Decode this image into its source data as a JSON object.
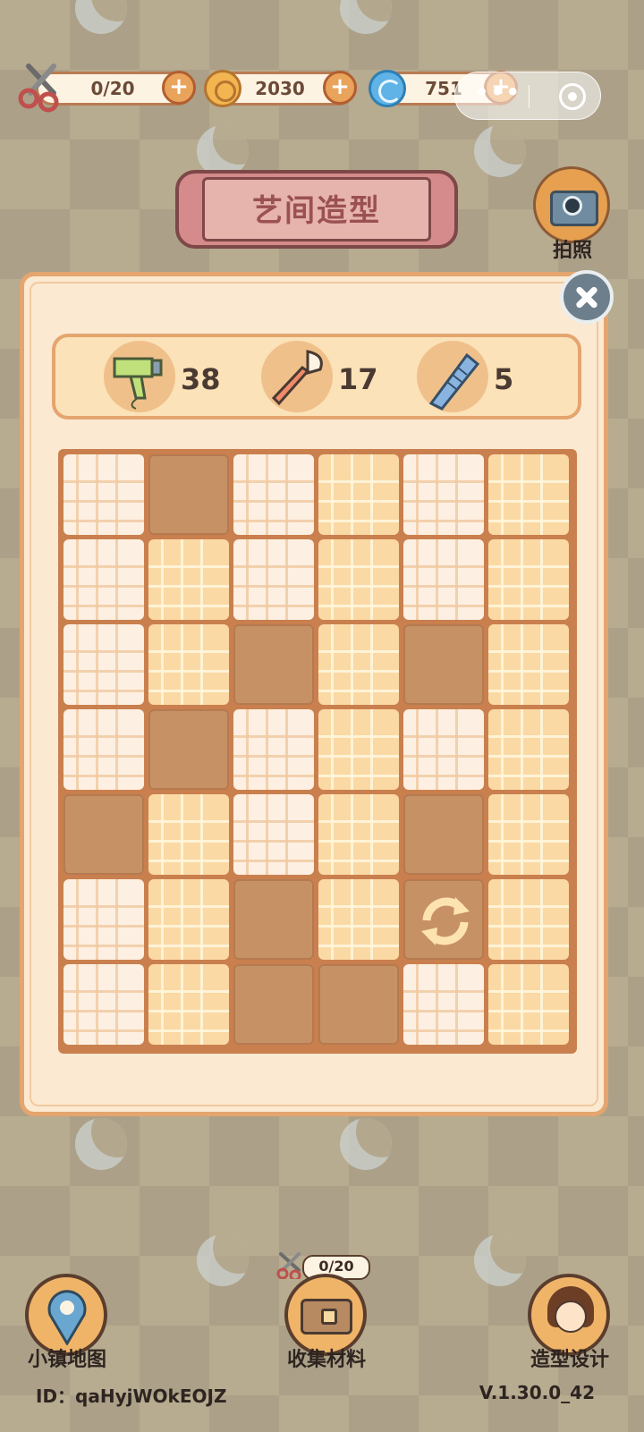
{
  "resources": {
    "scissors": {
      "value": "0/20",
      "icon": "scissors-icon"
    },
    "coins": {
      "value": "2030",
      "icon": "coin-icon"
    },
    "gems": {
      "value": "751",
      "icon": "swirl-gem-icon"
    }
  },
  "capsule": {
    "dots": "•••"
  },
  "title": "艺间造型",
  "camera_label": "拍照",
  "tools": [
    {
      "icon": "hair-dryer-icon",
      "count": "38"
    },
    {
      "icon": "makeup-brush-icon",
      "count": "17"
    },
    {
      "icon": "comb-icon",
      "count": "5"
    }
  ],
  "board": {
    "rows": [
      [
        "light",
        "empty",
        "light",
        "yellow",
        "light",
        "yellow"
      ],
      [
        "light",
        "yellow",
        "light",
        "yellow",
        "light",
        "yellow"
      ],
      [
        "light",
        "yellow",
        "empty",
        "yellow",
        "empty",
        "yellow"
      ],
      [
        "light",
        "empty",
        "light",
        "yellow",
        "light",
        "yellow"
      ],
      [
        "empty",
        "yellow",
        "light",
        "yellow",
        "empty",
        "yellow"
      ],
      [
        "light",
        "yellow",
        "empty",
        "yellow",
        "refresh",
        "yellow"
      ],
      [
        "light",
        "yellow",
        "empty",
        "empty",
        "light",
        "yellow"
      ]
    ]
  },
  "bottom": {
    "map_label": "小镇地图",
    "collect_label": "收集材料",
    "collect_counter": "0/20",
    "design_label": "造型设计"
  },
  "footer": {
    "id": "ID：qaHyjWOkEOJZ",
    "version": "V.1.30.0_42"
  },
  "colors": {
    "accent": "#e4a56f",
    "panel": "#fbe9d2",
    "empty_cell": "#c79166"
  }
}
